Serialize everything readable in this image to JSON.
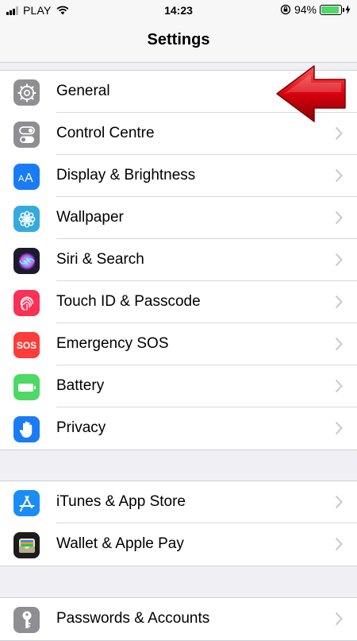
{
  "status_bar": {
    "carrier": "PLAY",
    "time": "14:23",
    "battery_percent": "94%",
    "battery_level": 0.94
  },
  "nav": {
    "title": "Settings"
  },
  "groups": [
    {
      "items": [
        {
          "label": "General",
          "icon": "gear-icon",
          "color": "#8e8e93"
        },
        {
          "label": "Control Centre",
          "icon": "toggles-icon",
          "color": "#8e8e93"
        },
        {
          "label": "Display & Brightness",
          "icon": "text-size-icon",
          "color": "#1a7cf5"
        },
        {
          "label": "Wallpaper",
          "icon": "flower-icon",
          "color": "#35aadc"
        },
        {
          "label": "Siri & Search",
          "icon": "siri-icon",
          "color": "#1b1b2e"
        },
        {
          "label": "Touch ID & Passcode",
          "icon": "fingerprint-icon",
          "color": "#fc3158"
        },
        {
          "label": "Emergency SOS",
          "icon": "sos-icon",
          "color": "#fc3d39",
          "icon_text": "SOS"
        },
        {
          "label": "Battery",
          "icon": "battery-icon",
          "color": "#4cd964"
        },
        {
          "label": "Privacy",
          "icon": "hand-icon",
          "color": "#1a7cf5"
        }
      ]
    },
    {
      "items": [
        {
          "label": "iTunes & App Store",
          "icon": "app-store-icon",
          "color": "#1a8df5"
        },
        {
          "label": "Wallet & Apple Pay",
          "icon": "wallet-icon",
          "color": "#1c1c1e"
        }
      ]
    },
    {
      "items": [
        {
          "label": "Passwords & Accounts",
          "icon": "key-icon",
          "color": "#8e8e93"
        }
      ]
    }
  ],
  "annotation": {
    "arrow_color": "#d8000c"
  }
}
